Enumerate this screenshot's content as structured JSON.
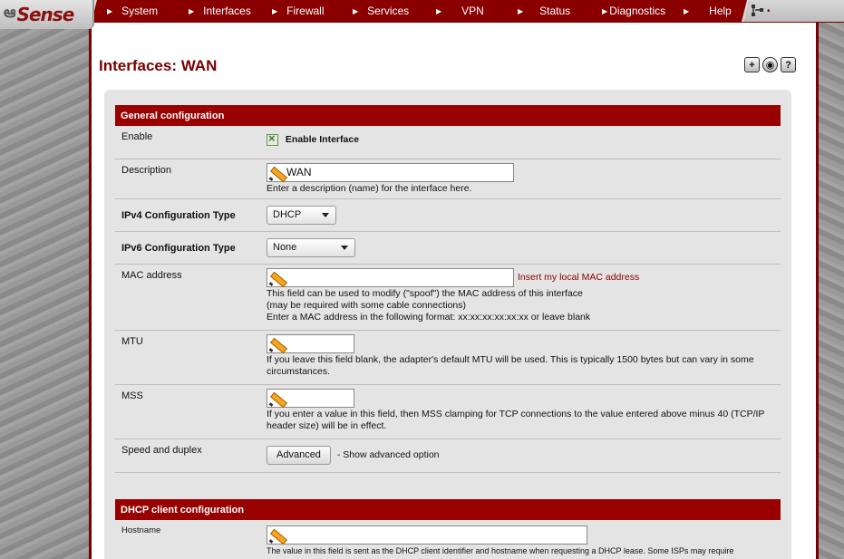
{
  "brand": {
    "name": "Sense",
    "mark": "ఆ"
  },
  "nav": {
    "items": [
      {
        "label": "System"
      },
      {
        "label": "Interfaces"
      },
      {
        "label": "Firewall"
      },
      {
        "label": "Services"
      },
      {
        "label": "VPN"
      },
      {
        "label": "Status"
      },
      {
        "label": "Diagnostics"
      },
      {
        "label": "Help"
      }
    ],
    "tool_icon": "network-map-icon"
  },
  "page": {
    "title": "Interfaces: WAN",
    "icons": [
      "add-icon",
      "log-icon",
      "help-icon"
    ]
  },
  "sections": {
    "general": {
      "title": "General configuration",
      "enable": {
        "label": "Enable",
        "checkbox_label": "Enable Interface",
        "checked": true
      },
      "description": {
        "label": "Description",
        "value": "WAN",
        "help": "Enter a description (name) for the interface here."
      },
      "ipv4": {
        "label": "IPv4 Configuration Type",
        "value": "DHCP"
      },
      "ipv6": {
        "label": "IPv6 Configuration Type",
        "value": "None"
      },
      "mac": {
        "label": "MAC address",
        "value": "",
        "link": "Insert my local MAC address",
        "help1": "This field can be used to modify (\"spoof\") the MAC address of this interface",
        "help2": "(may be required with some cable connections)",
        "help3": "Enter a MAC address in the following format: xx:xx:xx:xx:xx:xx or leave blank"
      },
      "mtu": {
        "label": "MTU",
        "value": "",
        "help1": "If you leave this field blank, the adapter's default MTU will be used. This is typically 1500 bytes but can vary in some",
        "help2": "circumstances."
      },
      "mss": {
        "label": "MSS",
        "value": "",
        "help1": "If you enter a value in this field, then MSS clamping for TCP connections to the value entered above minus 40 (TCP/IP",
        "help2": "header size) will be in effect."
      },
      "speed": {
        "label": "Speed and duplex",
        "button": "Advanced",
        "help": "- Show advanced option"
      }
    },
    "dhcp": {
      "title": "DHCP client configuration",
      "hostname": {
        "label": "Hostname",
        "value": "",
        "help": "The value in this field is sent as the DHCP client identifier and hostname when requesting a DHCP lease. Some ISPs may require"
      }
    }
  }
}
